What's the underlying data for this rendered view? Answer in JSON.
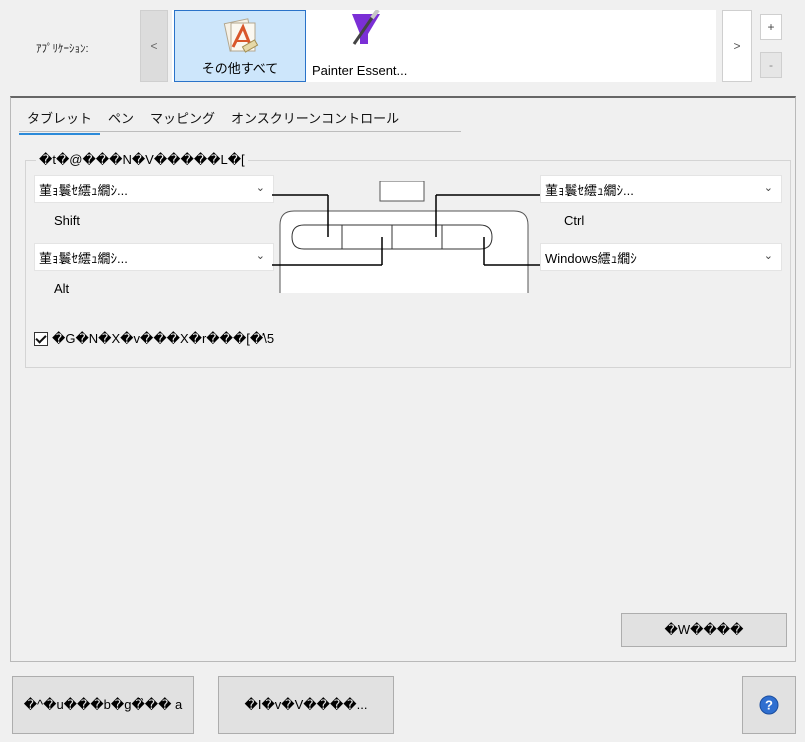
{
  "apps": {
    "label": "ｱﾌﾟﾘｹｰｼｮﾝ:",
    "scroll_left": "<",
    "scroll_right": ">",
    "add": "+",
    "remove": "-",
    "items": [
      {
        "name": "その他すべて",
        "icon": "all-apps-icon",
        "selected": true
      },
      {
        "name": "Painter Essent...",
        "icon": "painter-essentials-icon",
        "selected": false
      }
    ]
  },
  "tabs": [
    "タブレット",
    "ペン",
    "マッピング",
    "オンスクリーンコントロール"
  ],
  "active_tab": 0,
  "express_keys": {
    "group_title": "�t�@���N�V�����L�[",
    "left": [
      {
        "value": "菫ｮ鬟ｾ繧ｭ繝ｼ...",
        "modifier": "Shift"
      },
      {
        "value": "菫ｮ鬟ｾ繧ｭ繝ｼ...",
        "modifier": "Alt"
      }
    ],
    "right": [
      {
        "value": "菫ｮ鬟ｾ繧ｭ繝ｼ...",
        "modifier": "Ctrl"
      },
      {
        "value": "Windows繧ｭ繝ｼ",
        "modifier": ""
      }
    ],
    "show_setting": "�G�N�X�v���X�r���[�̕\\5"
  },
  "default_button": "�W����",
  "footer": {
    "left_button": "�^�u���b�g�̏�� a",
    "middle_button": "�I�v�V����...",
    "help_icon": "help-icon"
  },
  "colors": {
    "selection": "#cde6fb",
    "selection_border": "#2a73c9",
    "tab_accent": "#2b8ad9",
    "painter_purple": "#7b2fd6"
  }
}
